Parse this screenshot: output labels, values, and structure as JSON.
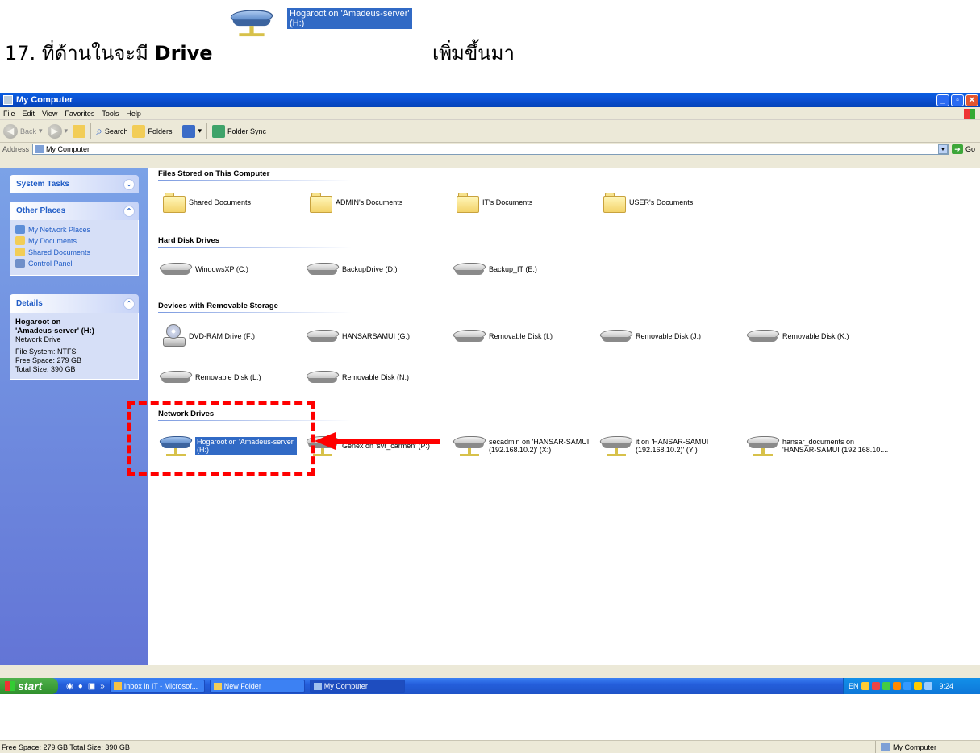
{
  "instruction": {
    "number": "17.",
    "text_before": "ที่ด้านในจะมี",
    "bold_word": "Drive",
    "drive_label_line1": "Hogaroot on 'Amadeus-server'",
    "drive_label_line2": "(H:)",
    "text_after": "เพิ่มขึ้นมา"
  },
  "window": {
    "title": "My Computer",
    "menu": [
      "File",
      "Edit",
      "View",
      "Favorites",
      "Tools",
      "Help"
    ],
    "toolbar": {
      "back": "Back",
      "search": "Search",
      "folders": "Folders",
      "folder_sync": "Folder Sync"
    },
    "address": {
      "label": "Address",
      "value": "My Computer",
      "go": "Go"
    }
  },
  "left_pane": {
    "system_tasks": {
      "title": "System Tasks"
    },
    "other_places": {
      "title": "Other Places",
      "items": [
        "My Network Places",
        "My Documents",
        "Shared Documents",
        "Control Panel"
      ]
    },
    "details": {
      "title": "Details",
      "name_line1": "Hogaroot on",
      "name_line2": "'Amadeus-server' (H:)",
      "type": "Network Drive",
      "file_system": "File System: NTFS",
      "free_space": "Free Space: 279 GB",
      "total_size": "Total Size: 390 GB"
    }
  },
  "groups": {
    "files": {
      "title": "Files Stored on This Computer",
      "items": [
        "Shared Documents",
        "ADMIN's Documents",
        "IT's Documents",
        "USER's Documents"
      ]
    },
    "hdd": {
      "title": "Hard Disk Drives",
      "items": [
        "WindowsXP (C:)",
        "BackupDrive (D:)",
        "Backup_IT (E:)"
      ]
    },
    "removable": {
      "title": "Devices with Removable Storage",
      "items": [
        "DVD-RAM Drive (F:)",
        "HANSARSAMUI (G:)",
        "Removable Disk (I:)",
        "Removable Disk (J:)",
        "Removable Disk (K:)",
        "Removable Disk (L:)",
        "Removable Disk (N:)"
      ]
    },
    "network": {
      "title": "Network Drives",
      "items": [
        {
          "line1": "Hogaroot on 'Amadeus-server'",
          "line2": "(H:)"
        },
        {
          "line1": "Genex on 'svr_carmen' (P:)",
          "line2": ""
        },
        {
          "line1": "secadmin on 'HANSAR-SAMUI",
          "line2": "(192.168.10.2)' (X:)"
        },
        {
          "line1": "it on 'HANSAR-SAMUI",
          "line2": "(192.168.10.2)' (Y:)"
        },
        {
          "line1": "hansar_documents on",
          "line2": "'HANSAR-SAMUI (192.168.10...."
        }
      ]
    }
  },
  "status_bar": {
    "left": "Free Space: 279 GB Total Size: 390 GB",
    "right": "My Computer"
  },
  "taskbar": {
    "start": "start",
    "tasks": [
      "Inbox in IT - Microsof...",
      "New Folder",
      "My Computer"
    ],
    "tray_lang": "EN",
    "clock": "9:24"
  },
  "colors": {
    "selection": "#316ac5",
    "annotation_red": "#ff0000",
    "left_pane_top": "#7ba2e7"
  }
}
